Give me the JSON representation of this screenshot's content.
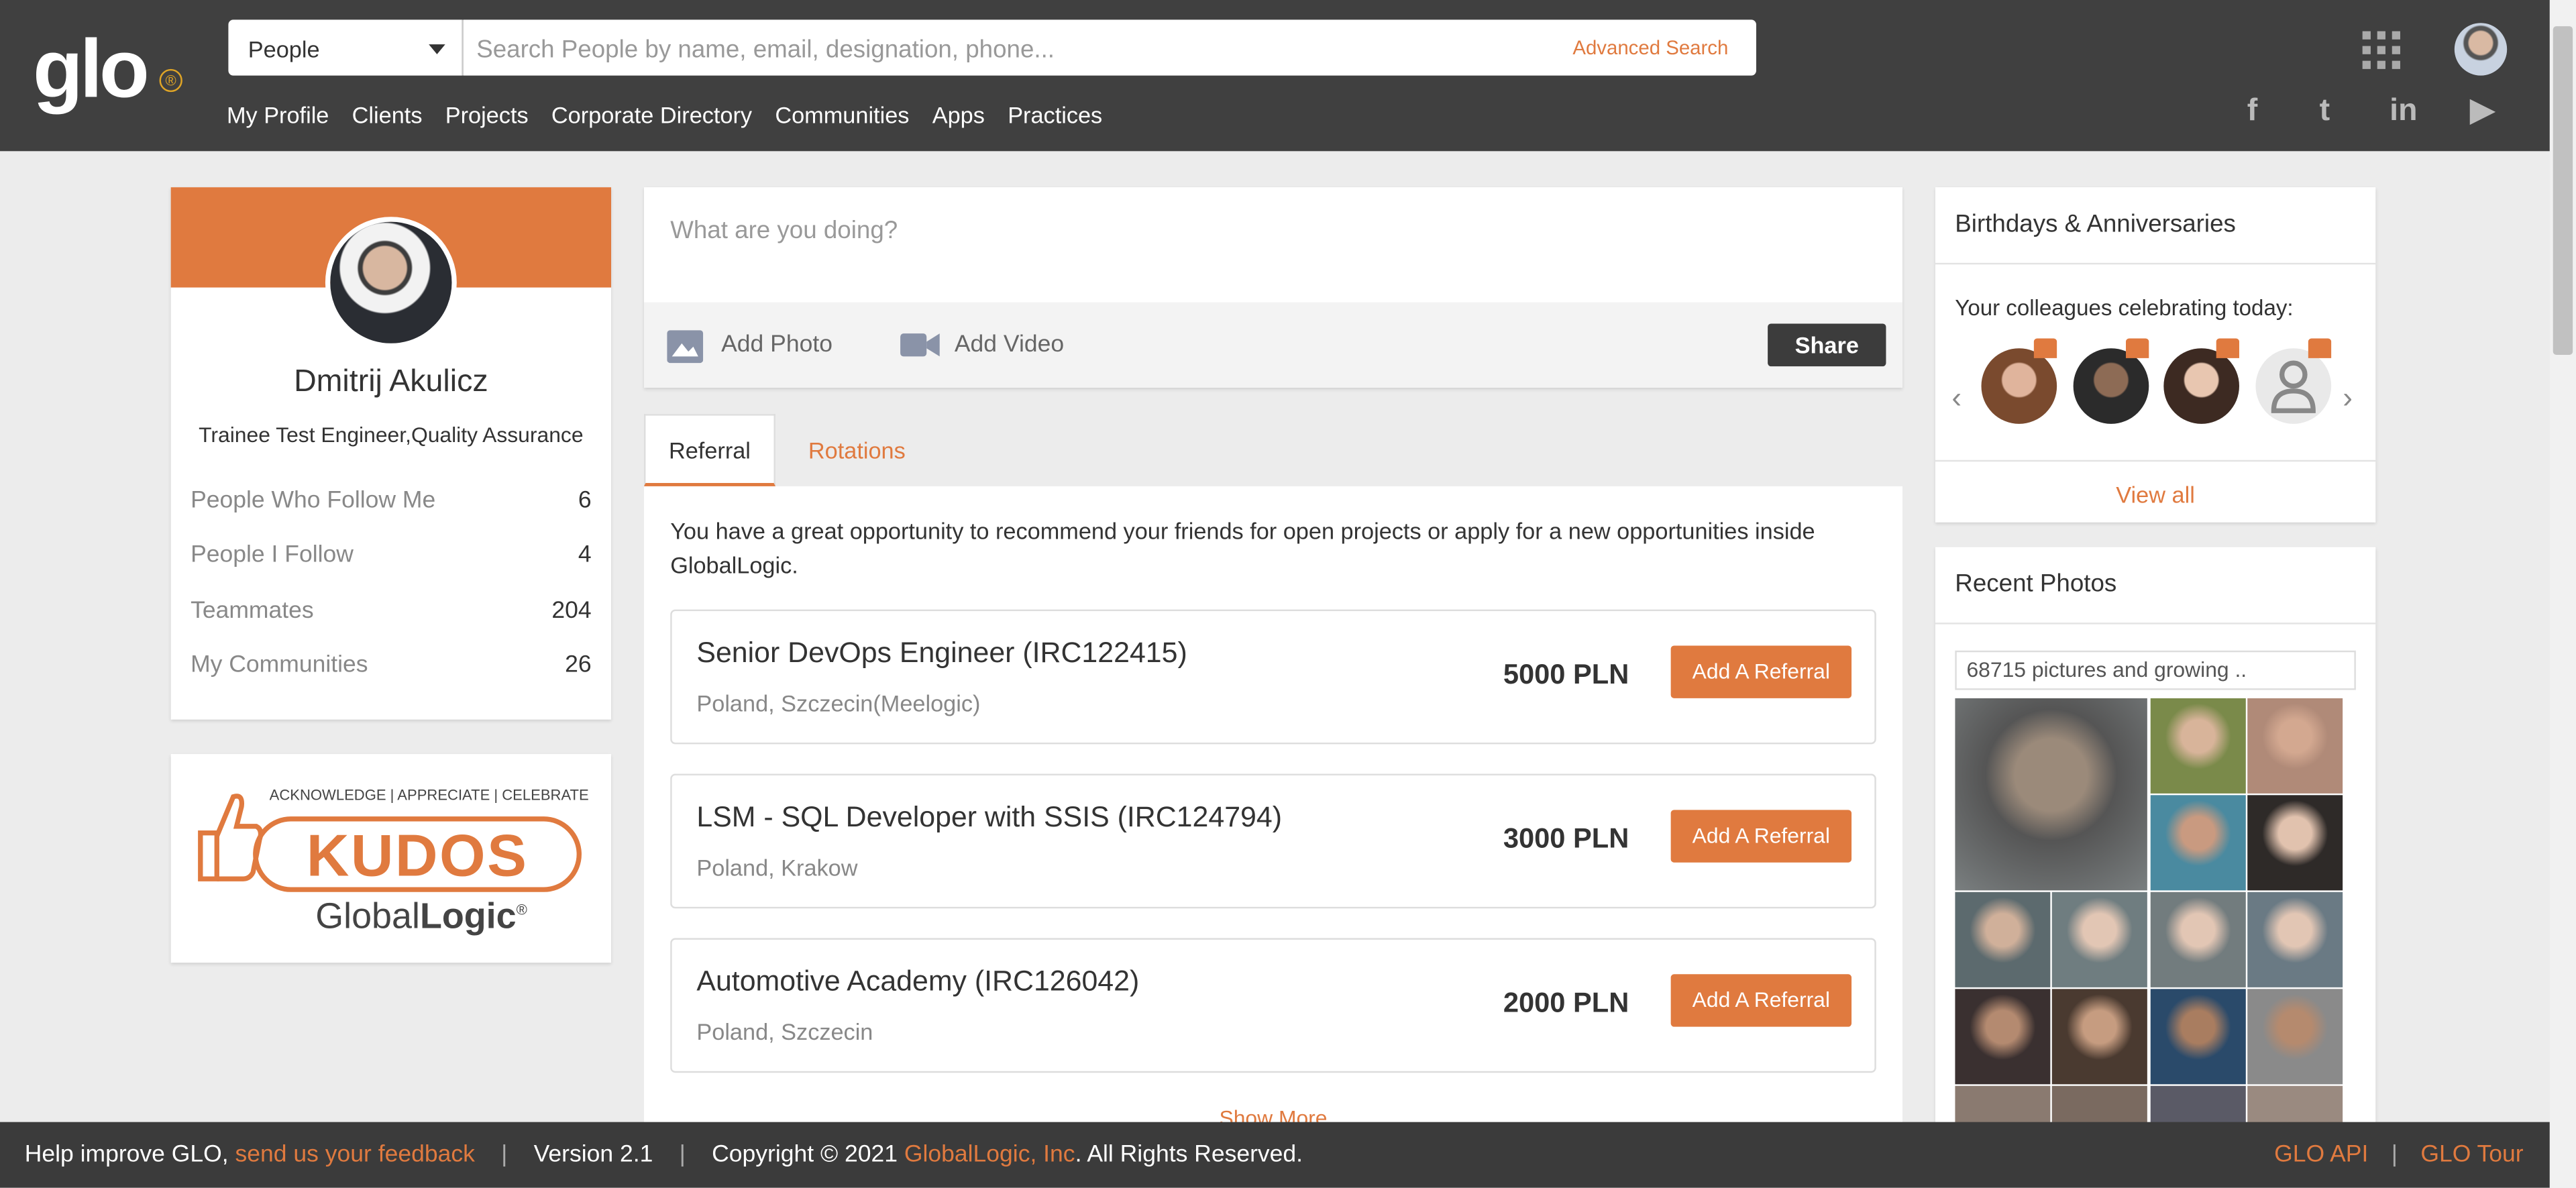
{
  "header": {
    "logo_text": "glo",
    "logo_mark": "®",
    "scope_select": "People",
    "search_placeholder": "Search People by name, email, designation, phone...",
    "advanced_search": "Advanced Search",
    "nav": [
      "My Profile",
      "Clients",
      "Projects",
      "Corporate Directory",
      "Communities",
      "Apps",
      "Practices"
    ],
    "social_icons": [
      "facebook-icon",
      "twitter-icon",
      "linkedin-icon",
      "youtube-icon"
    ],
    "social_glyphs": [
      "f",
      "t",
      "in",
      "▶"
    ]
  },
  "profile": {
    "name": "Dmitrij Akulicz",
    "title": "Trainee Test Engineer,Quality Assurance",
    "stats": [
      {
        "label": "People Who Follow Me",
        "value": "6"
      },
      {
        "label": "People I Follow",
        "value": "4"
      },
      {
        "label": "Teammates",
        "value": "204"
      },
      {
        "label": "My Communities",
        "value": "26"
      }
    ]
  },
  "kudos": {
    "tagline": "ACKNOWLEDGE | APPRECIATE | CELEBRATE",
    "word": "KUDOS",
    "brand_light": "Global",
    "brand_bold": "Logic",
    "brand_mark": "®"
  },
  "post": {
    "placeholder": "What are you doing?",
    "add_photo": "Add Photo",
    "add_video": "Add Video",
    "share": "Share"
  },
  "tabs": [
    "Referral",
    "Rotations"
  ],
  "referral": {
    "intro": "You have a great opportunity to recommend your friends for open projects or apply for a new opportunities inside GlobalLogic.",
    "jobs": [
      {
        "title": "Senior DevOps Engineer (IRC122415)",
        "location": "Poland, Szczecin(Meelogic)",
        "amount": "5000 PLN",
        "button": "Add A Referral"
      },
      {
        "title": "LSM - SQL Developer with SSIS (IRC124794)",
        "location": "Poland, Krakow",
        "amount": "3000 PLN",
        "button": "Add A Referral"
      },
      {
        "title": "Automotive Academy (IRC126042)",
        "location": "Poland, Szczecin",
        "amount": "2000 PLN",
        "button": "Add A Referral"
      }
    ],
    "show_more": "Show More"
  },
  "birthdays": {
    "heading": "Birthdays & Anniversaries",
    "subheading": "Your colleagues celebrating today:",
    "view_all": "View all"
  },
  "photos": {
    "heading": "Recent Photos",
    "count": "68715 pictures and growing .."
  },
  "footer": {
    "help": "Help improve GLO,",
    "feedback_link": "send us your feedback",
    "sep": "|",
    "version": "Version 2.1",
    "copyright_pre": "Copyright © 2021",
    "company": "GlobalLogic, Inc",
    "copyright_post": ". All Rights Reserved.",
    "api": "GLO API",
    "tour": "GLO Tour"
  },
  "colors": {
    "accent": "#e07a3f",
    "header_bg": "#404040",
    "footer_bg": "#3b3b3b",
    "page_bg": "#ececec"
  }
}
